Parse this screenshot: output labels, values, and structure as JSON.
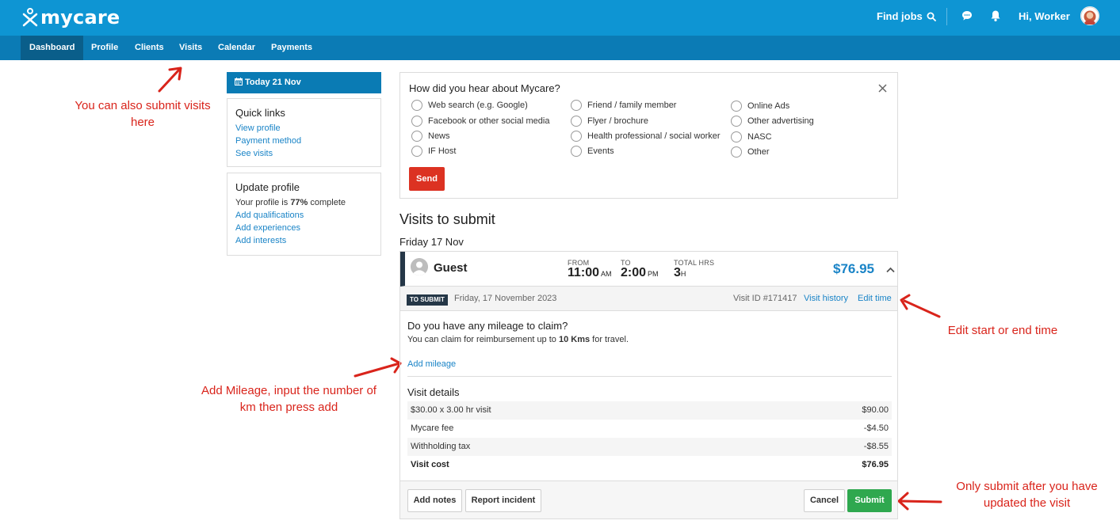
{
  "app": {
    "logo_text": "mycare",
    "find_jobs": "Find jobs",
    "greeting": "Hi, Worker"
  },
  "nav": {
    "items": [
      {
        "label": "Dashboard",
        "active": true
      },
      {
        "label": "Profile"
      },
      {
        "label": "Clients"
      },
      {
        "label": "Visits"
      },
      {
        "label": "Calendar"
      },
      {
        "label": "Payments"
      }
    ]
  },
  "sidebar": {
    "today": "Today 21 Nov",
    "quick_links": {
      "title": "Quick links",
      "links": [
        "View profile",
        "Payment method",
        "See visits"
      ]
    },
    "update_profile": {
      "title": "Update profile",
      "text_before": "Your profile is ",
      "percent": "77%",
      "text_after": " complete",
      "links": [
        "Add qualifications",
        "Add experiences",
        "Add interests"
      ]
    }
  },
  "survey": {
    "title": "How did you hear about Mycare?",
    "options": [
      "Web search (e.g. Google)",
      "Facebook or other social media",
      "News",
      "IF Host",
      "Friend / family member",
      "Flyer / brochure",
      "Health professional / social worker",
      "Events",
      "Online Ads",
      "Other advertising",
      "NASC",
      "Other"
    ],
    "send_label": "Send"
  },
  "visits": {
    "section_title": "Visits to submit",
    "date_heading": "Friday 17 Nov",
    "visit": {
      "client_name": "Guest",
      "from_label": "FROM",
      "from_time": "11:00",
      "from_ampm": "AM",
      "to_label": "TO",
      "to_time": "2:00",
      "to_ampm": "PM",
      "hours_label": "TOTAL HRS",
      "hours_value": "3",
      "hours_unit": "H",
      "price": "$76.95",
      "status_badge": "TO SUBMIT",
      "full_date": "Friday, 17 November 2023",
      "visit_id": "Visit ID #171417",
      "visit_history": "Visit history",
      "edit_time": "Edit time",
      "mileage_title": "Do you have any mileage to claim?",
      "mileage_desc_before": "You can claim for reimbursement up to ",
      "mileage_limit": "10 Kms",
      "mileage_desc_after": " for travel.",
      "add_mileage": "Add mileage",
      "details_title": "Visit details",
      "details": [
        {
          "label": "$30.00 x 3.00 hr visit",
          "amount": "$90.00"
        },
        {
          "label": "Mycare fee",
          "amount": "-$4.50"
        },
        {
          "label": "Withholding tax",
          "amount": "-$8.55"
        },
        {
          "label": "Visit cost",
          "amount": "$76.95"
        }
      ],
      "buttons": {
        "add_notes": "Add notes",
        "report_incident": "Report incident",
        "cancel": "Cancel",
        "submit": "Submit"
      }
    }
  },
  "annotations": {
    "visits_nav": "You can also submit visits here",
    "edit_time": "Edit start or end time",
    "add_mileage": "Add Mileage, input the number of km then press add",
    "submit": "Only submit after you have updated the visit"
  },
  "colors": {
    "header": "#0e95d3",
    "nav": "#0b7bb5",
    "annotation": "#d9241b",
    "link": "#1a84c7",
    "submit": "#2fa84f",
    "send": "#dc3222"
  }
}
